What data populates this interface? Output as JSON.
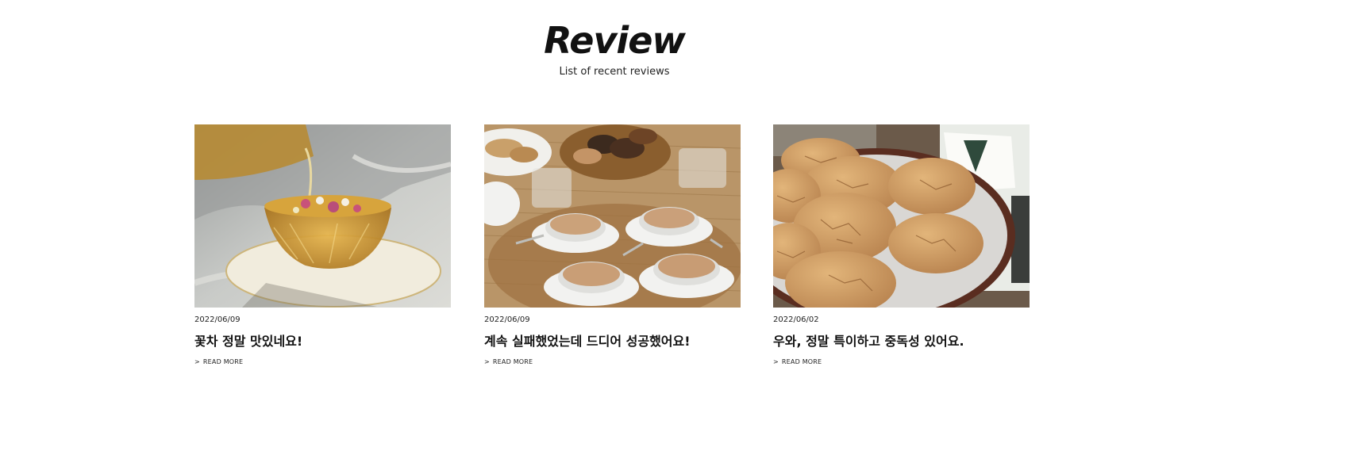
{
  "section": {
    "title": "Review",
    "subtitle": "List of recent reviews"
  },
  "reviews": [
    {
      "date": "2022/06/09",
      "title": "꽃차 정말 맛있네요!",
      "read_more": "READ MORE",
      "arrow": ">",
      "image": "flower-tea-photo"
    },
    {
      "date": "2022/06/09",
      "title": "계속 실패했었는데 드디어 성공했어요!",
      "read_more": "READ MORE",
      "arrow": ">",
      "image": "dalgona-coffee-photo"
    },
    {
      "date": "2022/06/02",
      "title": "우와, 정말 특이하고 중독성 있어요.",
      "read_more": "READ MORE",
      "arrow": ">",
      "image": "cookies-photo"
    }
  ]
}
